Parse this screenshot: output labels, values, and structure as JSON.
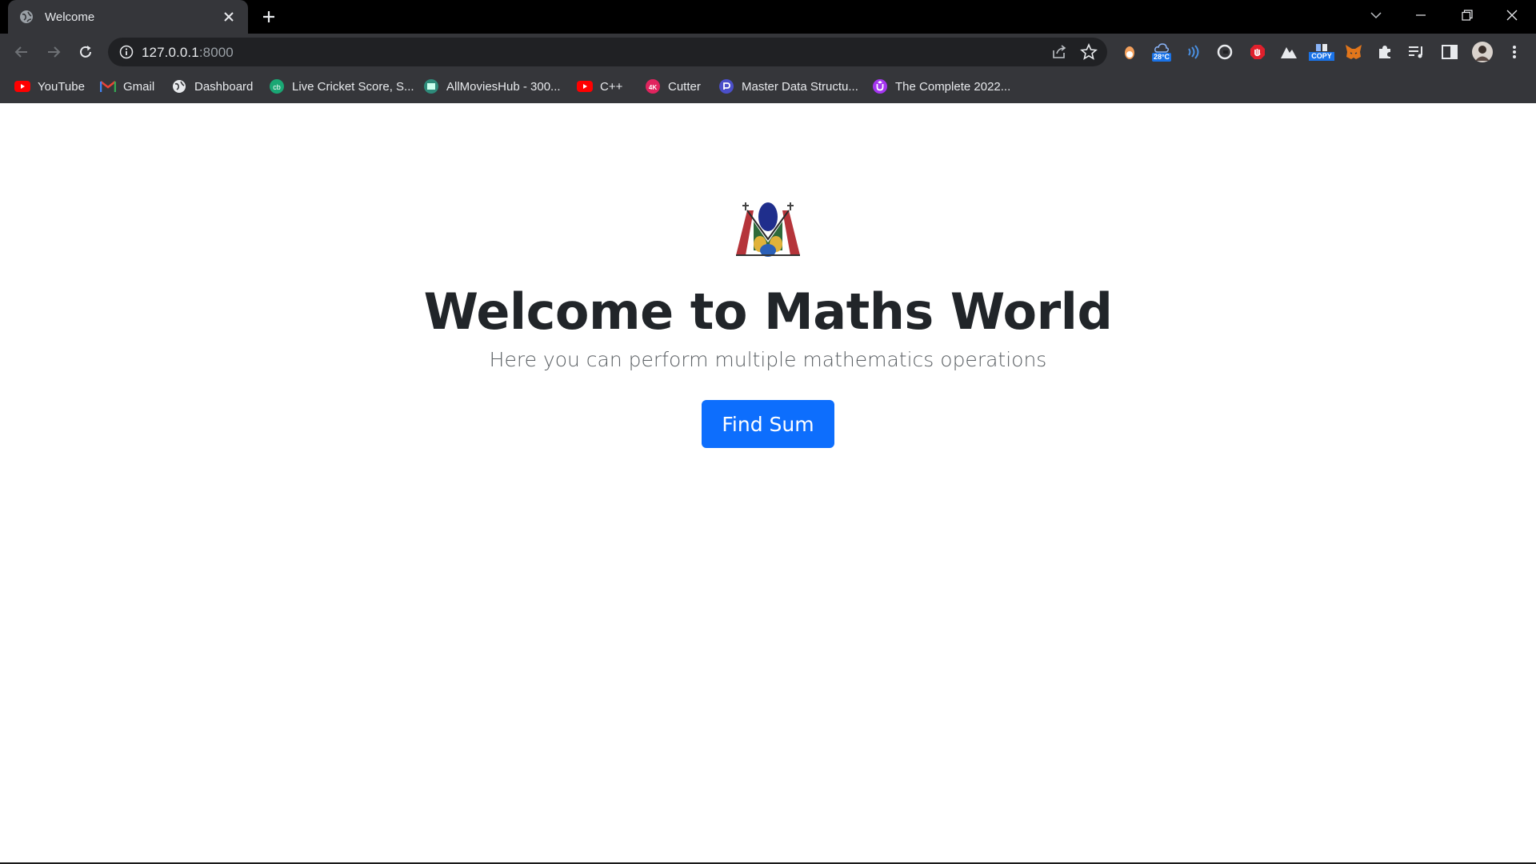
{
  "browser": {
    "tab_title": "Welcome",
    "url_host": "127.0.0.1",
    "url_port": ":8000",
    "weather_badge": "28°C",
    "copy_badge": "COPY",
    "bookmarks": [
      {
        "label": "YouTube"
      },
      {
        "label": "Gmail"
      },
      {
        "label": "Dashboard"
      },
      {
        "label": "Live Cricket Score, S..."
      },
      {
        "label": "AllMoviesHub - 300..."
      },
      {
        "label": "C++"
      },
      {
        "label": "Cutter"
      },
      {
        "label": "Master Data Structu..."
      },
      {
        "label": "The Complete 2022..."
      }
    ]
  },
  "page": {
    "title": "Welcome to Maths World",
    "subtitle": "Here you can perform multiple mathematics operations",
    "button_label": "Find Sum"
  },
  "colors": {
    "primary_button": "#0d6efd",
    "heading": "#212529",
    "browser_chrome": "#35363a"
  }
}
